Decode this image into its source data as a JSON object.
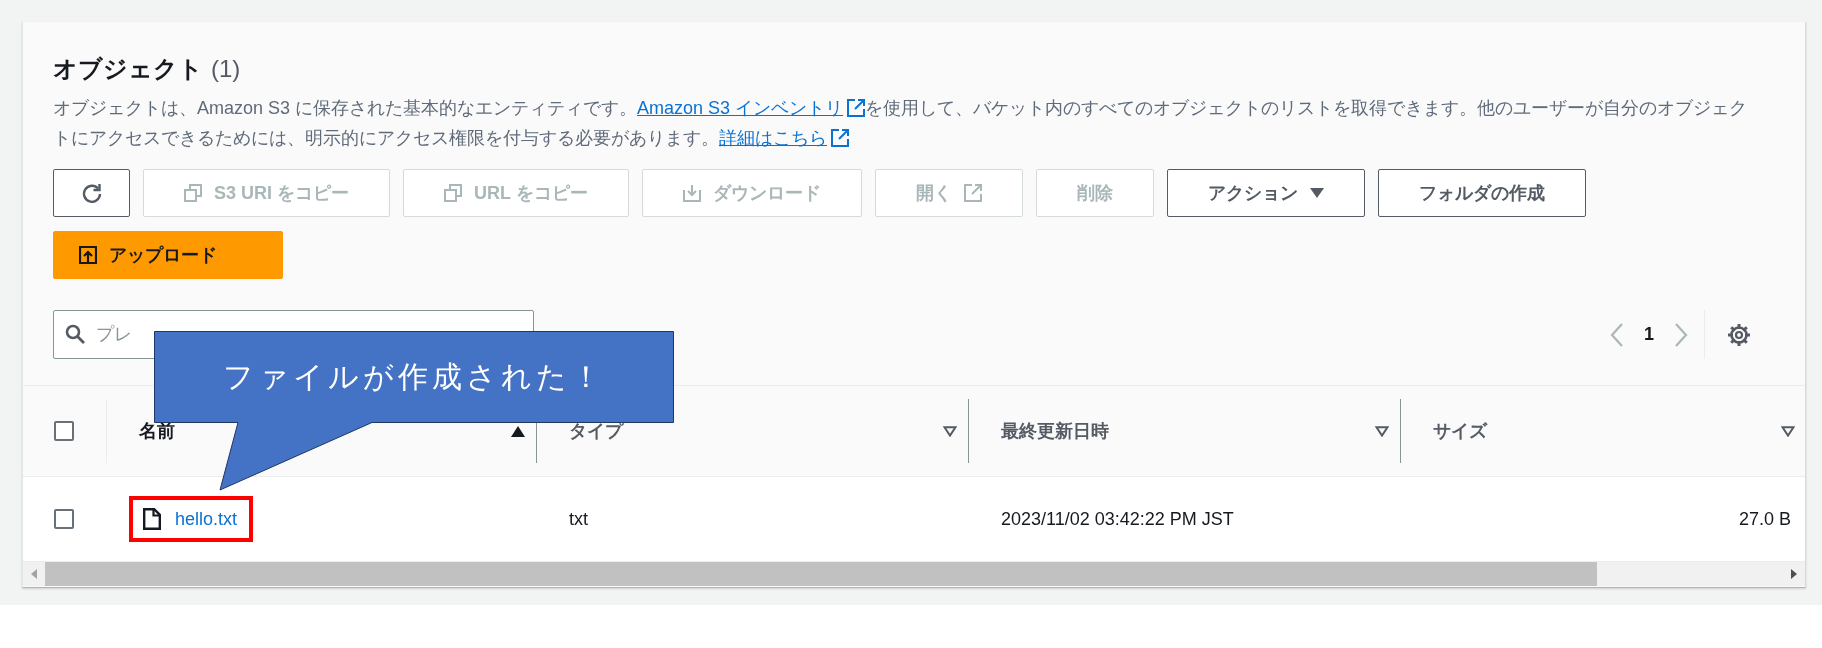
{
  "section": {
    "title": "オブジェクト",
    "count": "(1)",
    "description": [
      {
        "kind": "text",
        "text": "オブジェクトは、Amazon S3 に保存された基本的なエンティティです。"
      },
      {
        "kind": "link",
        "text": "Amazon S3 インベントリ"
      },
      {
        "kind": "text",
        "text": "を使用して、バケット内のすべてのオブジェクトのリストを取得できます。他のユーザーが自分のオブジェクトにアクセスできるためには、明示的にアクセス権限を付与する必要があります。"
      },
      {
        "kind": "link",
        "text": "詳細はこちら"
      }
    ]
  },
  "toolbar": [
    {
      "kind": "refresh",
      "disabled": false
    },
    {
      "kind": "copy",
      "label": "S3 URI をコピー",
      "disabled": true
    },
    {
      "kind": "copy",
      "label": "URL をコピー",
      "disabled": true
    },
    {
      "kind": "download",
      "label": "ダウンロード",
      "disabled": true
    },
    {
      "kind": "open",
      "label": "開く",
      "disabled": true
    },
    {
      "kind": "plain",
      "label": "削除",
      "disabled": true
    },
    {
      "kind": "dropdown",
      "label": "アクション",
      "disabled": false
    },
    {
      "kind": "plain",
      "label": "フォルダの作成",
      "disabled": false
    },
    {
      "kind": "upload",
      "label": "アップロード",
      "disabled": false
    }
  ],
  "search": {
    "placeholder": "プレ"
  },
  "pagination": {
    "page": "1",
    "prev_disabled": true,
    "next_disabled": true
  },
  "table": {
    "select_all": {
      "checked": false
    },
    "columns": [
      {
        "label": "名前",
        "sorted": true
      },
      {
        "label": "タイプ",
        "sorted": false
      },
      {
        "label": "最終更新日時",
        "sorted": false
      },
      {
        "label": "サイズ",
        "sorted": false
      }
    ],
    "rows": [
      {
        "checked": false,
        "name": "hello.txt",
        "type": "txt",
        "modified": "2023/11/02 03:42:22 PM JST",
        "size": "27.0 B",
        "highlighted": true
      }
    ]
  },
  "callout": {
    "text": "ファイルが作成された！"
  }
}
